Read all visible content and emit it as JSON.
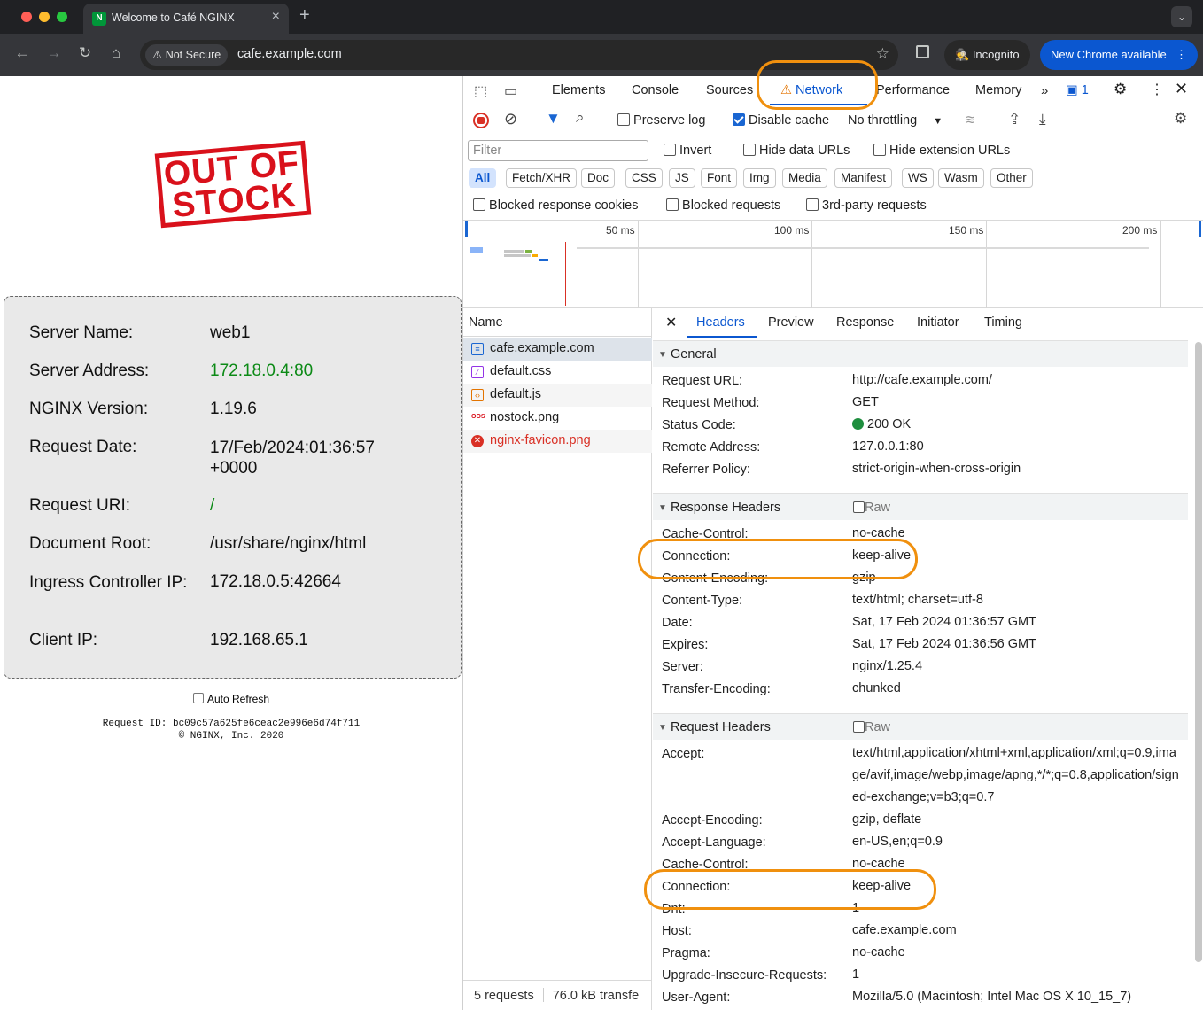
{
  "browser": {
    "tab_title": "Welcome to Café NGINX",
    "tab_favicon_letter": "N",
    "security_label": "Not Secure",
    "url": "cafe.example.com",
    "incognito_label": "Incognito",
    "update_label": "New Chrome available"
  },
  "page": {
    "stamp_text": "OUT OF STOCK",
    "info": [
      {
        "label": "Server Name:",
        "value": "web1"
      },
      {
        "label": "Server Address:",
        "value": "172.18.0.4:80"
      },
      {
        "label": "NGINX Version:",
        "value": "1.19.6"
      },
      {
        "label": "Request Date:",
        "value": "17/Feb/2024:01:36:57 +0000"
      },
      {
        "label": "Request URI:",
        "value": "/"
      },
      {
        "label": "Document Root:",
        "value": "/usr/share/nginx/html"
      },
      {
        "label": "Ingress Controller IP:",
        "value": "172.18.0.5:42664"
      },
      {
        "label": "Client IP:",
        "value": "192.168.65.1"
      }
    ],
    "auto_refresh_label": "Auto Refresh",
    "request_id": "Request ID: bc09c57a625fe6ceac2e996e6d74f711",
    "copyright": "© NGINX, Inc. 2020"
  },
  "devtools": {
    "tabs": [
      "Elements",
      "Console",
      "Sources",
      "Network",
      "Performance",
      "Memory"
    ],
    "issues_count": "1",
    "toolbar": {
      "preserve_log": "Preserve log",
      "disable_cache": "Disable cache",
      "throttling": "No throttling"
    },
    "filter_placeholder": "Filter",
    "filter_options": [
      "Invert",
      "Hide data URLs",
      "Hide extension URLs"
    ],
    "type_filters": [
      "All",
      "Fetch/XHR",
      "Doc",
      "CSS",
      "JS",
      "Font",
      "Img",
      "Media",
      "Manifest",
      "WS",
      "Wasm",
      "Other"
    ],
    "blocked_options": [
      "Blocked response cookies",
      "Blocked requests",
      "3rd-party requests"
    ],
    "timeline_labels": [
      "50 ms",
      "100 ms",
      "150 ms",
      "200 ms"
    ],
    "name_header": "Name",
    "requests": [
      {
        "name": "cafe.example.com",
        "type": "doc"
      },
      {
        "name": "default.css",
        "type": "css"
      },
      {
        "name": "default.js",
        "type": "js"
      },
      {
        "name": "nostock.png",
        "type": "img"
      },
      {
        "name": "nginx-favicon.png",
        "type": "error"
      }
    ],
    "summary_requests": "5 requests",
    "summary_transfer": "76.0 kB transfe",
    "detail_tabs": [
      "Headers",
      "Preview",
      "Response",
      "Initiator",
      "Timing"
    ],
    "general_title": "General",
    "general": [
      {
        "k": "Request URL:",
        "v": "http://cafe.example.com/"
      },
      {
        "k": "Request Method:",
        "v": "GET"
      },
      {
        "k": "Status Code:",
        "v": "200 OK"
      },
      {
        "k": "Remote Address:",
        "v": "127.0.0.1:80"
      },
      {
        "k": "Referrer Policy:",
        "v": "strict-origin-when-cross-origin"
      }
    ],
    "response_title": "Response Headers",
    "raw_label": "Raw",
    "response_headers": [
      {
        "k": "Cache-Control:",
        "v": "no-cache"
      },
      {
        "k": "Connection:",
        "v": "keep-alive"
      },
      {
        "k": "Content-Encoding:",
        "v": "gzip"
      },
      {
        "k": "Content-Type:",
        "v": "text/html; charset=utf-8"
      },
      {
        "k": "Date:",
        "v": "Sat, 17 Feb 2024 01:36:57 GMT"
      },
      {
        "k": "Expires:",
        "v": "Sat, 17 Feb 2024 01:36:56 GMT"
      },
      {
        "k": "Server:",
        "v": "nginx/1.25.4"
      },
      {
        "k": "Transfer-Encoding:",
        "v": "chunked"
      }
    ],
    "request_title": "Request Headers",
    "request_headers": [
      {
        "k": "Accept:",
        "v": "text/html,application/xhtml+xml,application/xml;q=0.9,image/avif,image/webp,image/apng,*/*;q=0.8,application/signed-exchange;v=b3;q=0.7"
      },
      {
        "k": "Accept-Encoding:",
        "v": "gzip, deflate"
      },
      {
        "k": "Accept-Language:",
        "v": "en-US,en;q=0.9"
      },
      {
        "k": "Cache-Control:",
        "v": "no-cache"
      },
      {
        "k": "Connection:",
        "v": "keep-alive"
      },
      {
        "k": "Dnt:",
        "v": "1"
      },
      {
        "k": "Host:",
        "v": "cafe.example.com"
      },
      {
        "k": "Pragma:",
        "v": "no-cache"
      },
      {
        "k": "Upgrade-Insecure-Requests:",
        "v": "1"
      },
      {
        "k": "User-Agent:",
        "v": "Mozilla/5.0 (Macintosh; Intel Mac OS X 10_15_7)"
      }
    ]
  },
  "colors": {
    "accent": "#0b57d0",
    "highlight": "#f0900e",
    "stamp": "#d9111b",
    "ok_green": "#0c8a16"
  }
}
